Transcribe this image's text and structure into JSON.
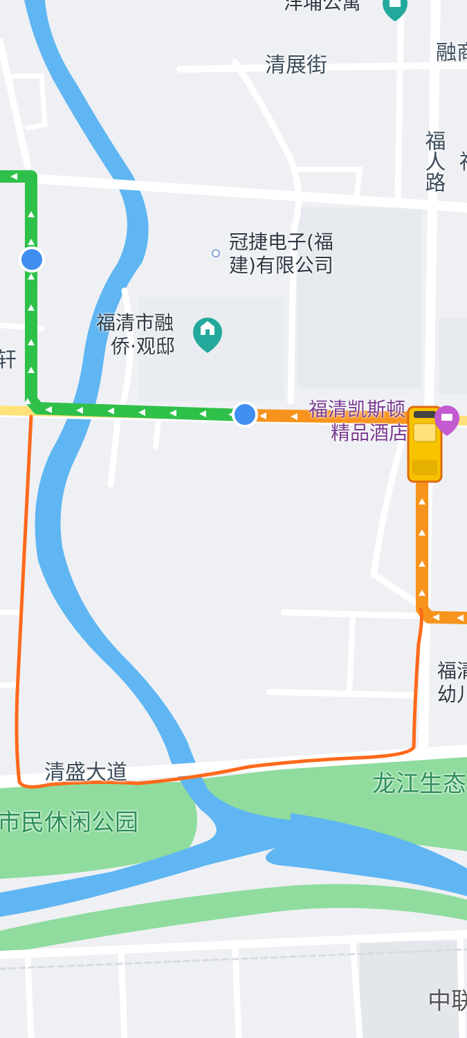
{
  "map": {
    "road_labels": [
      {
        "key": "qingzhan",
        "text": "清展街"
      },
      {
        "key": "furen",
        "text": "福人路"
      },
      {
        "key": "qingsheng",
        "text": "清盛大道"
      },
      {
        "key": "rong_top",
        "text": "融商"
      },
      {
        "key": "fu_side",
        "text": "福"
      },
      {
        "key": "xuan",
        "text": "轩"
      }
    ],
    "pois": {
      "yangpu": {
        "text": "洋埔公寓"
      },
      "guanjie": {
        "text": "冠捷电子(福建)有限公司"
      },
      "guanjie_line1": {
        "text": "冠捷电子(福"
      },
      "guanjie_line2": {
        "text": "建)有限公司"
      },
      "guandi_line1": {
        "text": "福清市融"
      },
      "guandi_line2": {
        "text": "侨·观邸"
      },
      "hotel_line1": {
        "text": "福清凯斯顿"
      },
      "hotel_line2": {
        "text": "精品酒店"
      },
      "kinder_line1": {
        "text": "福清"
      },
      "kinder_line2": {
        "text": "幼儿"
      },
      "zhong": {
        "text": "中联"
      }
    },
    "parks": {
      "shimin": {
        "text": "市民休闲公园"
      },
      "longjiang": {
        "text": "龙江生态"
      }
    },
    "route": {
      "green_segment_color": "#2fc04a",
      "orange_segment_color": "#f7941d",
      "drawn_path_color": "#ff6a1a",
      "stop_color": "#3f8ef0"
    },
    "colors": {
      "background": "#eef0f4",
      "road": "#ffffff",
      "water": "#5fb6f2",
      "park": "#8fdc9e",
      "main_road_yellow": "#ffe27a",
      "bus": "#f7c300"
    },
    "icons": [
      "apartment-pin-icon",
      "hotel-pin-icon",
      "bus-icon",
      "route-arrow-icon",
      "stop-dot-icon"
    ]
  }
}
